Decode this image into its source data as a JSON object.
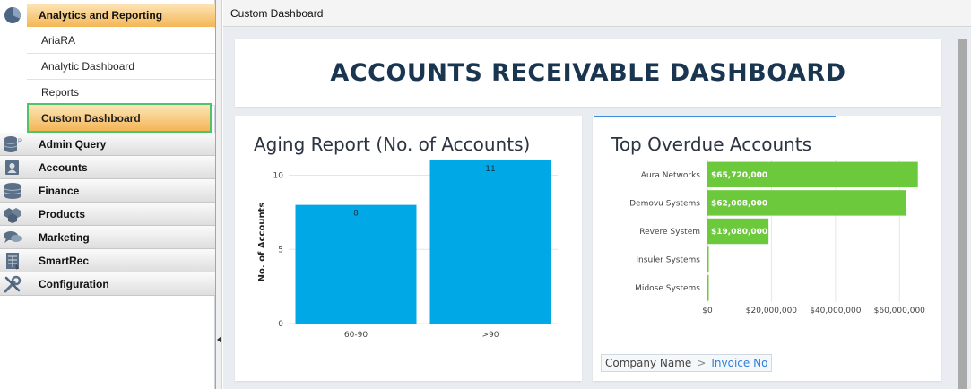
{
  "sidebar": {
    "sections": [
      {
        "label": "Analytics and Reporting",
        "icon": "pie-chart-icon",
        "active": true
      },
      {
        "label": "Admin Query",
        "icon": "database-icon"
      },
      {
        "label": "Accounts",
        "icon": "contact-card-icon"
      },
      {
        "label": "Finance",
        "icon": "coin-stack-icon"
      },
      {
        "label": "Products",
        "icon": "boxes-icon"
      },
      {
        "label": "Marketing",
        "icon": "speech-bubbles-icon"
      },
      {
        "label": "SmartRec",
        "icon": "spreadsheet-icon"
      },
      {
        "label": "Configuration",
        "icon": "wrench-screwdriver-icon"
      }
    ],
    "sub_items": [
      {
        "label": "AriaRA"
      },
      {
        "label": "Analytic Dashboard"
      },
      {
        "label": "Reports"
      },
      {
        "label": "Custom Dashboard",
        "selected": true
      }
    ]
  },
  "main": {
    "window_title": "Custom Dashboard",
    "dashboard_title": "ACCOUNTS RECEIVABLE DASHBOARD"
  },
  "chart_data": [
    {
      "type": "bar",
      "title": "Aging Report (No. of Accounts)",
      "xlabel": "",
      "ylabel": "No. of Accounts",
      "categories": [
        "60-90",
        ">90"
      ],
      "values": [
        8,
        11
      ],
      "data_labels": [
        "8",
        "11"
      ],
      "yticks": [
        "0",
        "5",
        "10"
      ],
      "ylim": [
        0,
        11
      ],
      "grid": true,
      "color": "#00a8e6"
    },
    {
      "type": "bar",
      "orientation": "horizontal",
      "title": "Top Overdue Accounts",
      "categories": [
        "Aura Networks",
        "Demovu Systems",
        "Revere System",
        "Insuler Systems",
        "Midose Systems"
      ],
      "values": [
        65720000,
        62008000,
        19080000,
        0,
        0
      ],
      "data_labels": [
        "$65,720,000",
        "$62,008,000",
        "$19,080,000",
        "",
        ""
      ],
      "xticks": [
        "$0",
        "$20,000,000",
        "$40,000,000",
        "$60,000,000"
      ],
      "xlim": [
        0,
        70000000
      ],
      "grid": true,
      "color": "#6cc93b"
    }
  ],
  "drilldown": {
    "root": "Company Name",
    "separator": ">",
    "leaf": "Invoice No"
  }
}
